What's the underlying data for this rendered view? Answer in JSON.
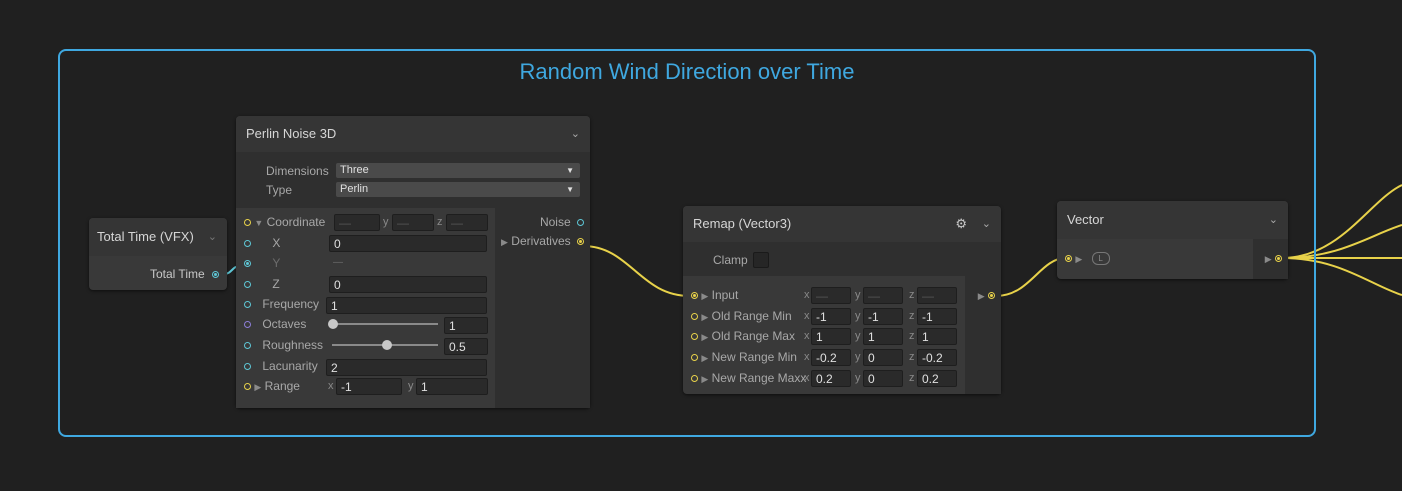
{
  "group": {
    "title": "Random Wind Direction over Time"
  },
  "total_time_node": {
    "title": "Total Time (VFX)",
    "output_label": "Total Time"
  },
  "perlin": {
    "title": "Perlin Noise 3D",
    "dimensions_label": "Dimensions",
    "dimensions_value": "Three",
    "type_label": "Type",
    "type_value": "Perlin",
    "coordinate_label": "Coordinate",
    "coord_axis_x": "x",
    "coord_axis_y": "y",
    "coord_axis_z": "z",
    "coord_dash": "—",
    "x_label": "X",
    "x_value": "0",
    "y_label": "Y",
    "y_value": "—",
    "z_label": "Z",
    "z_value": "0",
    "frequency_label": "Frequency",
    "frequency_value": "1",
    "octaves_label": "Octaves",
    "octaves_value": "1",
    "roughness_label": "Roughness",
    "roughness_value": "0.5",
    "lacunarity_label": "Lacunarity",
    "lacunarity_value": "2",
    "range_label": "Range",
    "range_x_axis": "x",
    "range_x_value": "-1",
    "range_y_axis": "y",
    "range_y_value": "1",
    "noise_label": "Noise",
    "derivatives_label": "Derivatives"
  },
  "remap": {
    "title": "Remap (Vector3)",
    "clamp_label": "Clamp",
    "input_label": "Input",
    "dash": "—",
    "axis_x": "x",
    "axis_y": "y",
    "axis_z": "z",
    "rows": [
      {
        "label": "Old Range Min",
        "x": "-1",
        "y": "-1",
        "z": "-1"
      },
      {
        "label": "Old Range Max",
        "x": "1",
        "y": "1",
        "z": "1"
      },
      {
        "label": "New Range Min",
        "x": "-0.2",
        "y": "0",
        "z": "-0.2"
      },
      {
        "label": "New Range Maxx",
        "x": "0.2",
        "y": "0",
        "z": "0.2"
      }
    ]
  },
  "vector": {
    "title": "Vector",
    "badge": "L"
  }
}
